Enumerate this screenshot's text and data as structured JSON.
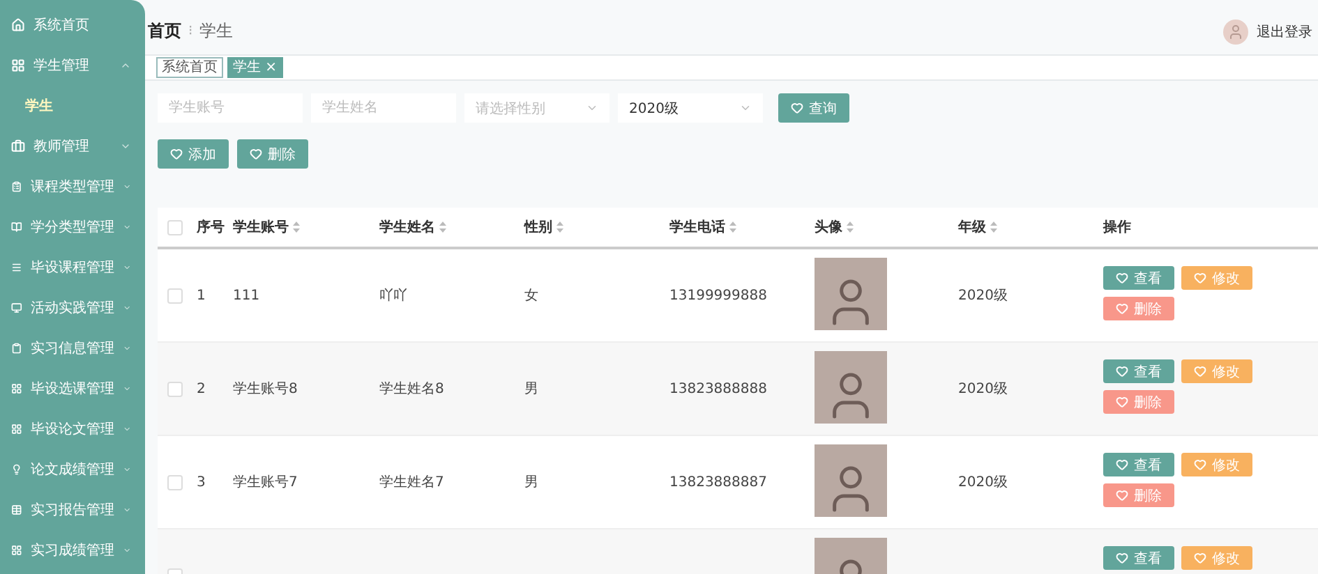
{
  "sidebar": {
    "items": [
      {
        "label": "系统首页",
        "expandable": false,
        "selected": false
      },
      {
        "label": "学生管理",
        "expandable": true,
        "expanded": true,
        "selected": false,
        "children": [
          {
            "label": "学生",
            "selected": true
          }
        ]
      },
      {
        "label": "教师管理",
        "expandable": true,
        "expanded": false,
        "selected": false
      },
      {
        "label": "课程类型管理",
        "expandable": true,
        "expanded": false,
        "selected": false
      },
      {
        "label": "学分类型管理",
        "expandable": true,
        "expanded": false,
        "selected": false
      },
      {
        "label": "毕设课程管理",
        "expandable": true,
        "expanded": false,
        "selected": false
      },
      {
        "label": "活动实践管理",
        "expandable": true,
        "expanded": false,
        "selected": false
      },
      {
        "label": "实习信息管理",
        "expandable": true,
        "expanded": false,
        "selected": false
      },
      {
        "label": "毕设选课管理",
        "expandable": true,
        "expanded": false,
        "selected": false
      },
      {
        "label": "毕设论文管理",
        "expandable": true,
        "expanded": false,
        "selected": false
      },
      {
        "label": "论文成绩管理",
        "expandable": true,
        "expanded": false,
        "selected": false
      },
      {
        "label": "实习报告管理",
        "expandable": true,
        "expanded": false,
        "selected": false
      },
      {
        "label": "实习成绩管理",
        "expandable": true,
        "expanded": false,
        "selected": false
      }
    ]
  },
  "header": {
    "breadcrumb": [
      "首页",
      "学生"
    ],
    "breadcrumb_separator": "⁝",
    "logout": "退出登录"
  },
  "tabs": [
    {
      "label": "系统首页",
      "selected": false,
      "closable": false
    },
    {
      "label": "学生",
      "selected": true,
      "closable": true,
      "close": "×"
    }
  ],
  "search": {
    "fields": [
      {
        "kind": "input",
        "placeholder": "学生账号"
      },
      {
        "kind": "input",
        "placeholder": "学生姓名"
      },
      {
        "kind": "select",
        "placeholder": "请选择性别"
      },
      {
        "kind": "select",
        "value": "2020级"
      }
    ],
    "button": "查询"
  },
  "actions": [
    "添加",
    "删除"
  ],
  "table": {
    "select_all_checked": false,
    "columns": [
      {
        "label": "序号",
        "sortable": false
      },
      {
        "label": "学生账号",
        "sortable": true
      },
      {
        "label": "学生姓名",
        "sortable": true
      },
      {
        "label": "性别",
        "sortable": true
      },
      {
        "label": "学生电话",
        "sortable": true
      },
      {
        "label": "头像",
        "sortable": true
      },
      {
        "label": "年级",
        "sortable": true
      },
      {
        "label": "操作",
        "sortable": false
      }
    ],
    "rows": [
      {
        "checked": false,
        "cells": [
          "1",
          "111",
          "吖吖",
          "女",
          "13199999888"
        ],
        "grade": "2020级",
        "actions": [
          {
            "kind": "view",
            "label": "查看"
          },
          {
            "kind": "edit",
            "label": "修改"
          },
          {
            "kind": "delete",
            "label": "删除"
          }
        ]
      },
      {
        "checked": false,
        "cells": [
          "2",
          "学生账号8",
          "学生姓名8",
          "男",
          "13823888888"
        ],
        "grade": "2020级",
        "actions": [
          {
            "kind": "view",
            "label": "查看"
          },
          {
            "kind": "edit",
            "label": "修改"
          },
          {
            "kind": "delete",
            "label": "删除"
          }
        ]
      },
      {
        "checked": false,
        "cells": [
          "3",
          "学生账号7",
          "学生姓名7",
          "男",
          "13823888887"
        ],
        "grade": "2020级",
        "actions": [
          {
            "kind": "view",
            "label": "查看"
          },
          {
            "kind": "edit",
            "label": "修改"
          },
          {
            "kind": "delete",
            "label": "删除"
          }
        ]
      },
      {
        "checked": false,
        "cells": [],
        "actions": [
          {
            "kind": "view",
            "label": "查看"
          },
          {
            "kind": "edit",
            "label": "修改"
          }
        ]
      }
    ]
  }
}
